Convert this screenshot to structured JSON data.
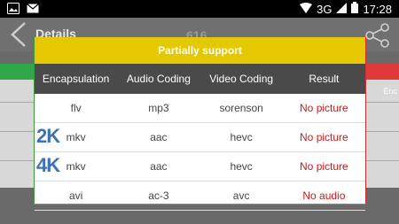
{
  "status_bar": {
    "network": "3G",
    "time": "17:28",
    "icons": [
      "photo-icon",
      "email-icon",
      "wifi-icon",
      "signal-icon",
      "battery-icon"
    ]
  },
  "background": {
    "title": "Details",
    "count": "616",
    "right_label": "Enc"
  },
  "dialog": {
    "title": "Partially support",
    "headers": [
      "Encapsulation",
      "Audio Coding",
      "Video Coding",
      "Result"
    ],
    "rows": [
      {
        "badge": "",
        "encapsulation": "flv",
        "audio": "mp3",
        "video": "sorenson",
        "result": "No picture"
      },
      {
        "badge": "2K",
        "encapsulation": "mkv",
        "audio": "aac",
        "video": "hevc",
        "result": "No picture"
      },
      {
        "badge": "4K",
        "encapsulation": "mkv",
        "audio": "aac",
        "video": "hevc",
        "result": "No picture"
      },
      {
        "badge": "",
        "encapsulation": "avi",
        "audio": "ac-3",
        "video": "avc",
        "result": "No audio"
      }
    ]
  },
  "colors": {
    "title_bar": "#e6c800",
    "header_bg": "#4a4a4a",
    "result_text": "#d01818",
    "badge": "#3c72b8"
  }
}
